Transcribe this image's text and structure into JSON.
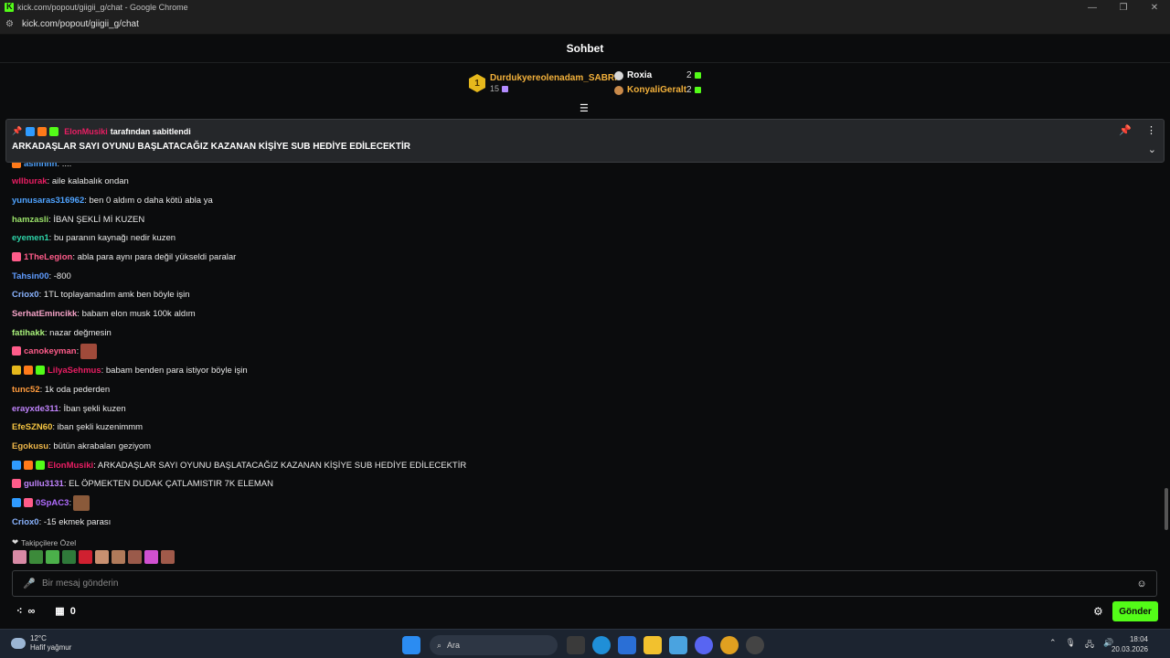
{
  "window": {
    "title": "kick.com/popout/giigii_g/chat - Google Chrome",
    "url": "kick.com/popout/giigii_g/chat"
  },
  "header": {
    "title": "Sohbet"
  },
  "leaderboard": {
    "first": {
      "rank": "1",
      "name": "Durdukyereolenadam_SABRI",
      "count": "15"
    },
    "second": {
      "name": "Roxia",
      "count": "2"
    },
    "third": {
      "name": "KonyaliGeralt",
      "count": "2"
    }
  },
  "pinned": {
    "pinned_by_user": "ElonMusiki",
    "pinned_by_text": "tarafından sabitlendi",
    "message": "ARKADAŞLAR SAYI OYUNU BAŞLATACAĞIZ KAZANAN KİŞİYE SUB HEDİYE EDİLECEKTİR"
  },
  "messages": [
    {
      "user": "wllburak",
      "color": "#e91e63",
      "text": ": aile kalabalık ondan"
    },
    {
      "user": "yunusaras316962",
      "color": "#4fa3ff",
      "text": ": ben 0 aldım o daha kötü abla ya"
    },
    {
      "user": "hamzasli",
      "color": "#9be36a",
      "text": ": İBAN ŞEKLİ Mİ KUZEN"
    },
    {
      "user": "eyemen1",
      "color": "#2ed3a8",
      "text": ": bu paranın kaynağı nedir kuzen"
    },
    {
      "user": "1TheLegion",
      "color": "#ff5c8a",
      "text": ": abla para aynı para değil yükseldi paralar"
    },
    {
      "user": "Tahsin00",
      "color": "#5f9cff",
      "text": ": -800"
    },
    {
      "user": "Criox0",
      "color": "#8ab4ff",
      "text": ": 1TL toplayamadım amk ben böyle işin"
    },
    {
      "user": "SerhatEmincikk",
      "color": "#f5a3c7",
      "text": ": babam elon musk 100k aldım"
    },
    {
      "user": "fatihakk",
      "color": "#a8f07a",
      "text": ": nazar değmesin"
    },
    {
      "user": "canokeyman",
      "color": "#ff5c8a",
      "text": ":"
    },
    {
      "user": "LilyaSehmus",
      "color": "#e91e63",
      "text": ": babam benden para istiyor böyle işin"
    },
    {
      "user": "tunc52",
      "color": "#ff9b3d",
      "text": ": 1k oda pederden"
    },
    {
      "user": "erayxde311",
      "color": "#c084fc",
      "text": ": İban şekli kuzen"
    },
    {
      "user": "EfeSZN60",
      "color": "#f5c542",
      "text": ": iban şekli kuzenimmm"
    },
    {
      "user": "Egokusu",
      "color": "#f0b84a",
      "text": ": bütün akrabaları geziyom"
    },
    {
      "user": "ElonMusiki",
      "color": "#e91e63",
      "text": ": ARKADAŞLAR SAYI OYUNU BAŞLATACAĞIZ KAZANAN KİŞİYE SUB HEDİYE EDİLECEKTİR"
    },
    {
      "user": "gullu3131",
      "color": "#c084fc",
      "text": ": EL ÖPMEKTEN DUDAK ÇATLAMISTIR 7K ELEMAN"
    },
    {
      "user": "0SpAC3",
      "color": "#b06cff",
      "text": ":"
    },
    {
      "user": "Criox0",
      "color": "#8ab4ff",
      "text": ": -15 ekmek parası"
    }
  ],
  "followers_only_label": "Takipçilere Özel",
  "input": {
    "placeholder": "Bir mesaj gönderin"
  },
  "footer": {
    "infinity": "∞",
    "gift_count": "0",
    "send_label": "Gönder"
  },
  "taskbar": {
    "temp": "12°C",
    "weather": "Hafif yağmur",
    "search_label": "Ara",
    "time": "18:04",
    "date": "20.03.2026"
  },
  "colors": {
    "accent": "#53fc18",
    "background": "#0b0c0d",
    "gold": "#f3b13b"
  }
}
